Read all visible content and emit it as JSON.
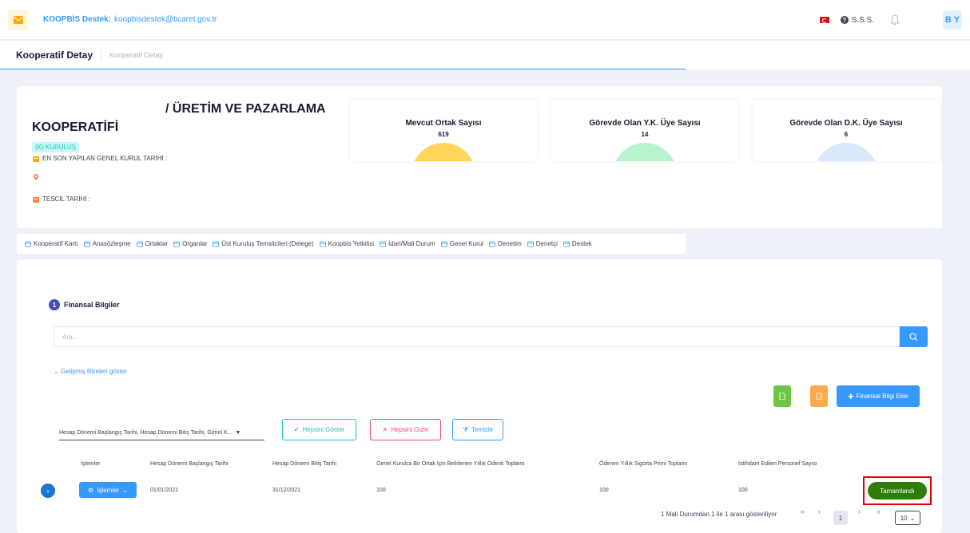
{
  "topbar": {
    "support_label": "KOOPBİS Destek:",
    "support_email": "koopbisdestek@ticaret.gov.tr",
    "faq": "S.S.S.",
    "avatar_initials": "B Y"
  },
  "subheader": {
    "title": "Kooperatif Detay",
    "breadcrumb": "Kooperatif Detay"
  },
  "cooperative": {
    "name_suffix": "/ ÜRETİM VE PAZARLAMA",
    "name": "KOOPERATİFİ",
    "status_badge": "(K) KURULUŞ",
    "last_assembly_label": "EN SON YAPILAN GENEL KURUL TARİHİ :",
    "registration_label": "TESCİL TARİHİ :"
  },
  "stats": [
    {
      "title": "Mevcut Ortak Sayısı",
      "value": "619",
      "color": "#ffd55a"
    },
    {
      "title": "Görevde Olan Y.K. Üye Sayısı",
      "value": "14",
      "color": "#b8f2cf"
    },
    {
      "title": "Görevde Olan D.K. Üye Sayısı",
      "value": "6",
      "color": "#dbe7fb"
    }
  ],
  "tabs": [
    "Kooperatif Kartı",
    "Anasözleşme",
    "Ortaklar",
    "Organlar",
    "Üst Kuruluş Temsilcileri (Delege)",
    "Koopbis Yetkilisi",
    "İdari/Mali Durum",
    "Genel Kurul",
    "Denetim",
    "Denetçi",
    "Destek"
  ],
  "section": {
    "step": "1",
    "title": "Finansal Bilgiler"
  },
  "search": {
    "placeholder": "Ara...",
    "value": ""
  },
  "filters": {
    "advanced": "Gelişmiş filtreleri göster",
    "column_select": "Hesap Dönemi Başlangıç Tarihi, Hesap Dönemi Bitiş Tarihi, Genel K...",
    "show_all": "Hepsini Göster",
    "hide_all": "Hepsini Gizle",
    "clear": "Temizle"
  },
  "actions": {
    "add": "Finansal Bilgi Ekle",
    "excel_color": "#6cc644",
    "pdf_color": "#ffa94d"
  },
  "table": {
    "headers": [
      "İşlemler",
      "Hesap Dönemi Başlangıç Tarihi",
      "Hesap Dönemi Bitiş Tarihi",
      "Genel Kurulca Bir Ortak İçin Belirlenen Yıllık Ödenti Toplamı",
      "Ödenen Yıllık Sigorta Primi Toplamı",
      "İstihdam Edilen Personel Sayısı"
    ],
    "rows": [
      {
        "actions": "İşlemler",
        "start": "01/01/2021",
        "end": "31/12/2021",
        "fee_total": "100",
        "insurance_total": "100",
        "personnel": "100",
        "status": "Tamamlandı"
      }
    ]
  },
  "pagination": {
    "summary": "1 Mali Durumdan 1 ile 1 arası gösteriliyor",
    "first": "«",
    "prev": "‹",
    "current": "1",
    "next": "›",
    "last": "»",
    "page_size": "10"
  }
}
